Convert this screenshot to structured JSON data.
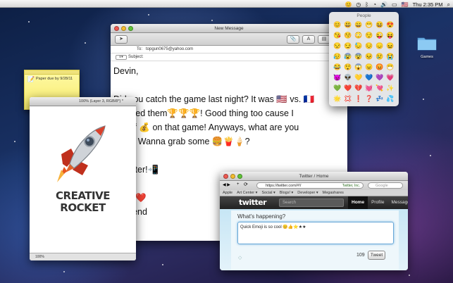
{
  "menubar": {
    "clock": "Thu 2:35 PM",
    "icons": [
      "emoji-icon",
      "time-machine-icon",
      "bluetooth-icon",
      "wifi-icon",
      "volume-icon",
      "battery-icon",
      "flag-icon"
    ]
  },
  "desktop": {
    "folder_label": "Games"
  },
  "mail": {
    "title": "New Message",
    "to_label": "To:",
    "to_value": "topgun0675@yahoo.com",
    "subject_label": "Subject:",
    "subject_value": "",
    "body": [
      "Devin,",
      "",
      "Did you catch the game last night? It was 🇺🇸 vs. 🇫🇷",
      "ve killed them🏆🏆🏆! Good thing too cause I",
      "ot's of 💰 on that game! Anyways, what are you",
      " later? Wanna grab some 🍔🍟🍦?",
      "",
      "me later!📲",
      "",
      "❤️❤️❤️",
      "girlfriend"
    ]
  },
  "emoji_palette": {
    "title": "People",
    "emojis": [
      "😊",
      "😃",
      "😄",
      "😁",
      "😆",
      "😍",
      "😘",
      "😚",
      "😳",
      "😌",
      "😜",
      "😝",
      "😒",
      "😏",
      "😓",
      "😔",
      "😞",
      "😖",
      "😥",
      "😰",
      "😨",
      "😣",
      "😢",
      "😭",
      "😂",
      "😲",
      "😱",
      "😠",
      "😡",
      "😷",
      "👿",
      "👽",
      "💛",
      "💙",
      "💜",
      "💗",
      "💚",
      "❤️",
      "💔",
      "💓",
      "💘",
      "✨",
      "🌟",
      "💢",
      "❗",
      "❓",
      "💤",
      "💦"
    ]
  },
  "sticky": {
    "text": "Paper due by 9/28/11"
  },
  "image_window": {
    "title": "100% (Layer 3, RGB/8*) *",
    "label_line1": "CREATIVE",
    "label_line2": "ROCKET",
    "zoom": "100%"
  },
  "twitter": {
    "window_title": "Twitter / Home",
    "url": "https://twitter.com/#!/",
    "site_identity": "Twitter, Inc.",
    "search_placeholder": "Google",
    "bookmarks": [
      "Apple",
      "Art Center ▾",
      "Social ▾",
      "Blogs! ▾",
      "Developer ▾",
      "Megashares"
    ],
    "logo": "twitter",
    "search_box": "Search",
    "nav": [
      "Home",
      "Profile",
      "Messages"
    ],
    "prompt": "What's happening?",
    "tweet_text": "Quick Emoji is so cool 😊👍⭐★★",
    "char_count": "109",
    "tweet_button": "Tweet"
  }
}
